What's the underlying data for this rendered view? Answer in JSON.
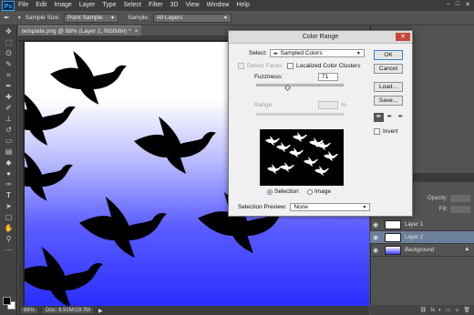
{
  "menubar": {
    "logo": "Ps",
    "items": [
      "File",
      "Edit",
      "Image",
      "Layer",
      "Type",
      "Select",
      "Filter",
      "3D",
      "View",
      "Window",
      "Help"
    ],
    "controls": [
      "–",
      "□",
      "✕"
    ]
  },
  "options": {
    "sample_size_label": "Sample Size:",
    "sample_size_value": "Point Sample",
    "sample_label": "Sample:",
    "sample_value": "All Layers"
  },
  "document": {
    "tab_title": "template.png @ 88% (Layer 2, RGB/8#) *",
    "tab_close": "×"
  },
  "status": {
    "zoom": "88%",
    "doc": "Doc: 9.91M/19.7M"
  },
  "layers_panel": {
    "opacity_label": "Opacity:",
    "fill_label": "Fill:",
    "layers": [
      {
        "name": "Layer 1",
        "selected": false
      },
      {
        "name": "Layer 2",
        "selected": true
      },
      {
        "name": "Background",
        "selected": false
      }
    ]
  },
  "dialog": {
    "title": "Color Range",
    "close": "✕",
    "select_label": "Select:",
    "select_value": "Sampled Colors",
    "detect_faces": "Detect Faces",
    "localized": "Localized Color Clusters",
    "fuzziness_label": "Fuzziness:",
    "fuzziness_value": "71",
    "range_label": "Range:",
    "range_unit": "%",
    "selection_radio": "Selection",
    "image_radio": "Image",
    "preview_label": "Selection Preview:",
    "preview_value": "None",
    "ok": "OK",
    "cancel": "Cancel",
    "load": "Load...",
    "save": "Save...",
    "invert": "Invert"
  }
}
